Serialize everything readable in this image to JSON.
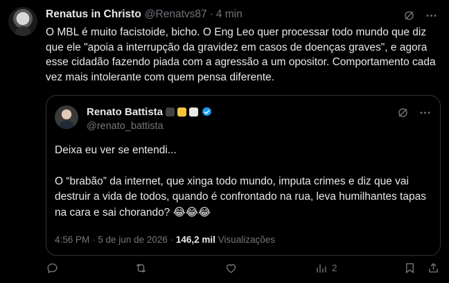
{
  "post": {
    "author_name": "Renatus in Christo",
    "handle": "@Renatvs87",
    "separator": "·",
    "time": "4 min",
    "text": "O MBL é muito facistoide, bicho. O Eng Leo quer processar todo mundo que diz que ele \"apoia a interrupção da gravidez em casos de doenças graves\", e agora esse cidadão fazendo piada com a agressão a um opositor. Comportamento cada vez mais intolerante com quem pensa diferente."
  },
  "quote": {
    "author_name": "Renato Battista",
    "handle": "@renato_battista",
    "paragraph1": "Deixa eu ver se entendi...",
    "paragraph2": "O “brabão” da internet, que xinga todo mundo, imputa crimes e diz que vai destruir a vida de todos, quando é confrontado na rua, leva humilhantes tapas na cara e sai chorando? 😂😂😂",
    "timestamp": "4:56 PM · 5 de jun de 2026 · ",
    "views_count": "146,2 mil",
    "views_label": " Visualizações"
  },
  "actions": {
    "views_count": "2"
  },
  "icons": {
    "grok": "grok-icon",
    "more": "more-icon",
    "reply": "reply-icon",
    "retweet": "retweet-icon",
    "like": "like-icon",
    "views": "views-icon",
    "bookmark": "bookmark-icon",
    "share": "share-icon",
    "verified": "verified-badge-icon"
  },
  "colors": {
    "background": "#000000",
    "text": "#e7e9ea",
    "muted": "#71767b",
    "border": "#2f3336",
    "verified": "#1d9bf0"
  }
}
